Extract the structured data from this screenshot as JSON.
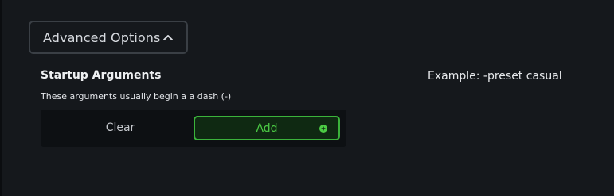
{
  "advanced_options": {
    "label": "Advanced Options",
    "expanded": true,
    "icon": "chevron-up-icon"
  },
  "startup_arguments": {
    "title": "Startup Arguments",
    "help_text": "These arguments usually begin a a dash (-)",
    "example": "Example: -preset casual",
    "buttons": {
      "clear_label": "Clear",
      "add_label": "Add",
      "add_icon": "plus-circle-icon"
    }
  },
  "colors": {
    "background": "#15181c",
    "accent_green": "#3bb33b",
    "add_button_bg": "#0f2912",
    "border": "#3a3f45"
  }
}
